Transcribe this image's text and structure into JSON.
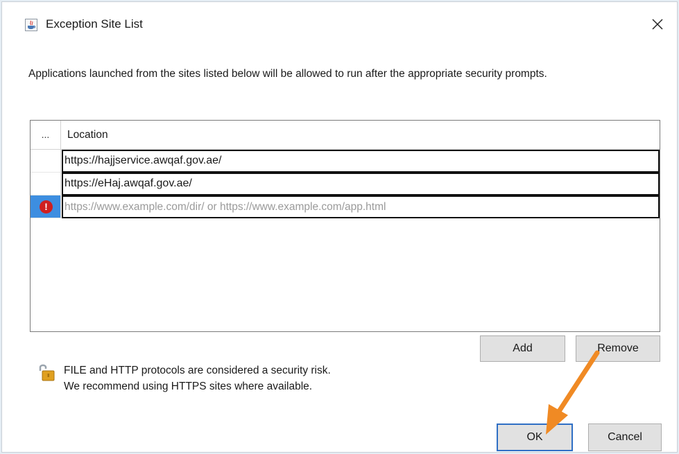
{
  "window": {
    "title": "Exception Site List",
    "close_glyph": "✕"
  },
  "description": "Applications launched from the sites listed below will be allowed to run after the appropriate security prompts.",
  "table": {
    "header_dots": "...",
    "header_location": "Location",
    "rows": [
      {
        "value": "https://hajjservice.awqaf.gov.ae/"
      },
      {
        "value": "https://eHaj.awqaf.gov.ae/"
      }
    ],
    "new_row_placeholder": "https://www.example.com/dir/ or https://www.example.com/app.html",
    "error_glyph": "!"
  },
  "buttons": {
    "add": "Add",
    "remove": "Remove",
    "ok": "OK",
    "cancel": "Cancel"
  },
  "security_note": {
    "line1": "FILE and HTTP protocols are considered a security risk.",
    "line2": "We recommend using HTTPS sites where available."
  },
  "colors": {
    "selected_row": "#3d8ee0",
    "error": "#cf1f1f",
    "annotation_arrow": "#f08a24",
    "ok_border": "#2f6fc5"
  },
  "icons": [
    "java-app-icon",
    "close-icon",
    "error-icon",
    "lock-icon",
    "annotation-arrow"
  ]
}
